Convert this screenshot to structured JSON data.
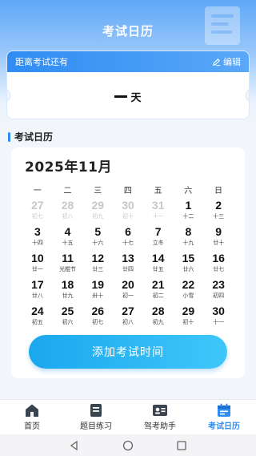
{
  "header": {
    "title": "考试日历"
  },
  "countdown": {
    "label": "距离考试还有",
    "edit_label": "编辑",
    "value": "",
    "unit": "天"
  },
  "section": {
    "title": "考试日历"
  },
  "calendar": {
    "month_label": "2025年11月",
    "weekdays": [
      "一",
      "二",
      "三",
      "四",
      "五",
      "六",
      "日"
    ],
    "days": [
      {
        "num": "27",
        "lunar": "初七",
        "muted": true
      },
      {
        "num": "28",
        "lunar": "初八",
        "muted": true
      },
      {
        "num": "29",
        "lunar": "初九",
        "muted": true
      },
      {
        "num": "30",
        "lunar": "初十",
        "muted": true
      },
      {
        "num": "31",
        "lunar": "十一",
        "muted": true
      },
      {
        "num": "1",
        "lunar": "十二",
        "muted": false
      },
      {
        "num": "2",
        "lunar": "十三",
        "muted": false
      },
      {
        "num": "3",
        "lunar": "十四",
        "muted": false
      },
      {
        "num": "4",
        "lunar": "十五",
        "muted": false
      },
      {
        "num": "5",
        "lunar": "十六",
        "muted": false
      },
      {
        "num": "6",
        "lunar": "十七",
        "muted": false
      },
      {
        "num": "7",
        "lunar": "立冬",
        "muted": false
      },
      {
        "num": "8",
        "lunar": "十九",
        "muted": false
      },
      {
        "num": "9",
        "lunar": "廿十",
        "muted": false
      },
      {
        "num": "10",
        "lunar": "廿一",
        "muted": false
      },
      {
        "num": "11",
        "lunar": "光棍节",
        "muted": false
      },
      {
        "num": "12",
        "lunar": "廿三",
        "muted": false
      },
      {
        "num": "13",
        "lunar": "廿四",
        "muted": false
      },
      {
        "num": "14",
        "lunar": "廿五",
        "muted": false
      },
      {
        "num": "15",
        "lunar": "廿六",
        "muted": false
      },
      {
        "num": "16",
        "lunar": "廿七",
        "muted": false
      },
      {
        "num": "17",
        "lunar": "廿八",
        "muted": false
      },
      {
        "num": "18",
        "lunar": "廿九",
        "muted": false
      },
      {
        "num": "19",
        "lunar": "卅十",
        "muted": false
      },
      {
        "num": "20",
        "lunar": "初一",
        "muted": false
      },
      {
        "num": "21",
        "lunar": "初二",
        "muted": false
      },
      {
        "num": "22",
        "lunar": "小雪",
        "muted": false
      },
      {
        "num": "23",
        "lunar": "初四",
        "muted": false
      },
      {
        "num": "24",
        "lunar": "初五",
        "muted": false
      },
      {
        "num": "25",
        "lunar": "初六",
        "muted": false
      },
      {
        "num": "26",
        "lunar": "初七",
        "muted": false
      },
      {
        "num": "27",
        "lunar": "初八",
        "muted": false
      },
      {
        "num": "28",
        "lunar": "初九",
        "muted": false
      },
      {
        "num": "29",
        "lunar": "初十",
        "muted": false
      },
      {
        "num": "30",
        "lunar": "十一",
        "muted": false
      }
    ],
    "add_button_label": "添加考试时间"
  },
  "tabbar": {
    "items": [
      {
        "label": "首页",
        "icon": "home-icon",
        "active": false
      },
      {
        "label": "题目练习",
        "icon": "notebook-icon",
        "active": false
      },
      {
        "label": "驾考助手",
        "icon": "id-card-icon",
        "active": false
      },
      {
        "label": "考试日历",
        "icon": "calendar-icon",
        "active": true
      }
    ]
  },
  "colors": {
    "accent": "#2f8cf2",
    "button_gradient_start": "#1aa7ee",
    "button_gradient_end": "#3ec7f9"
  }
}
